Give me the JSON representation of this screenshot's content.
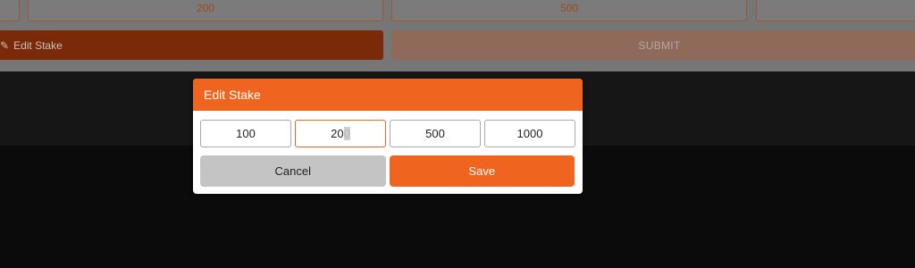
{
  "background": {
    "stakes": [
      "",
      "200",
      "500",
      ""
    ],
    "edit_stake_label": "Edit Stake",
    "edit_icon": "pencil-icon",
    "submit_label": "SUBMIT"
  },
  "modal": {
    "title": "Edit Stake",
    "stake_values": [
      "100",
      "200",
      "500",
      "1000"
    ],
    "active_index": 1,
    "cancel_label": "Cancel",
    "save_label": "Save"
  },
  "colors": {
    "accent": "#ef6520",
    "cancel_bg": "#c4c4c4",
    "overlay_panel": "#767676",
    "page_bg": "#0b0b0b"
  }
}
